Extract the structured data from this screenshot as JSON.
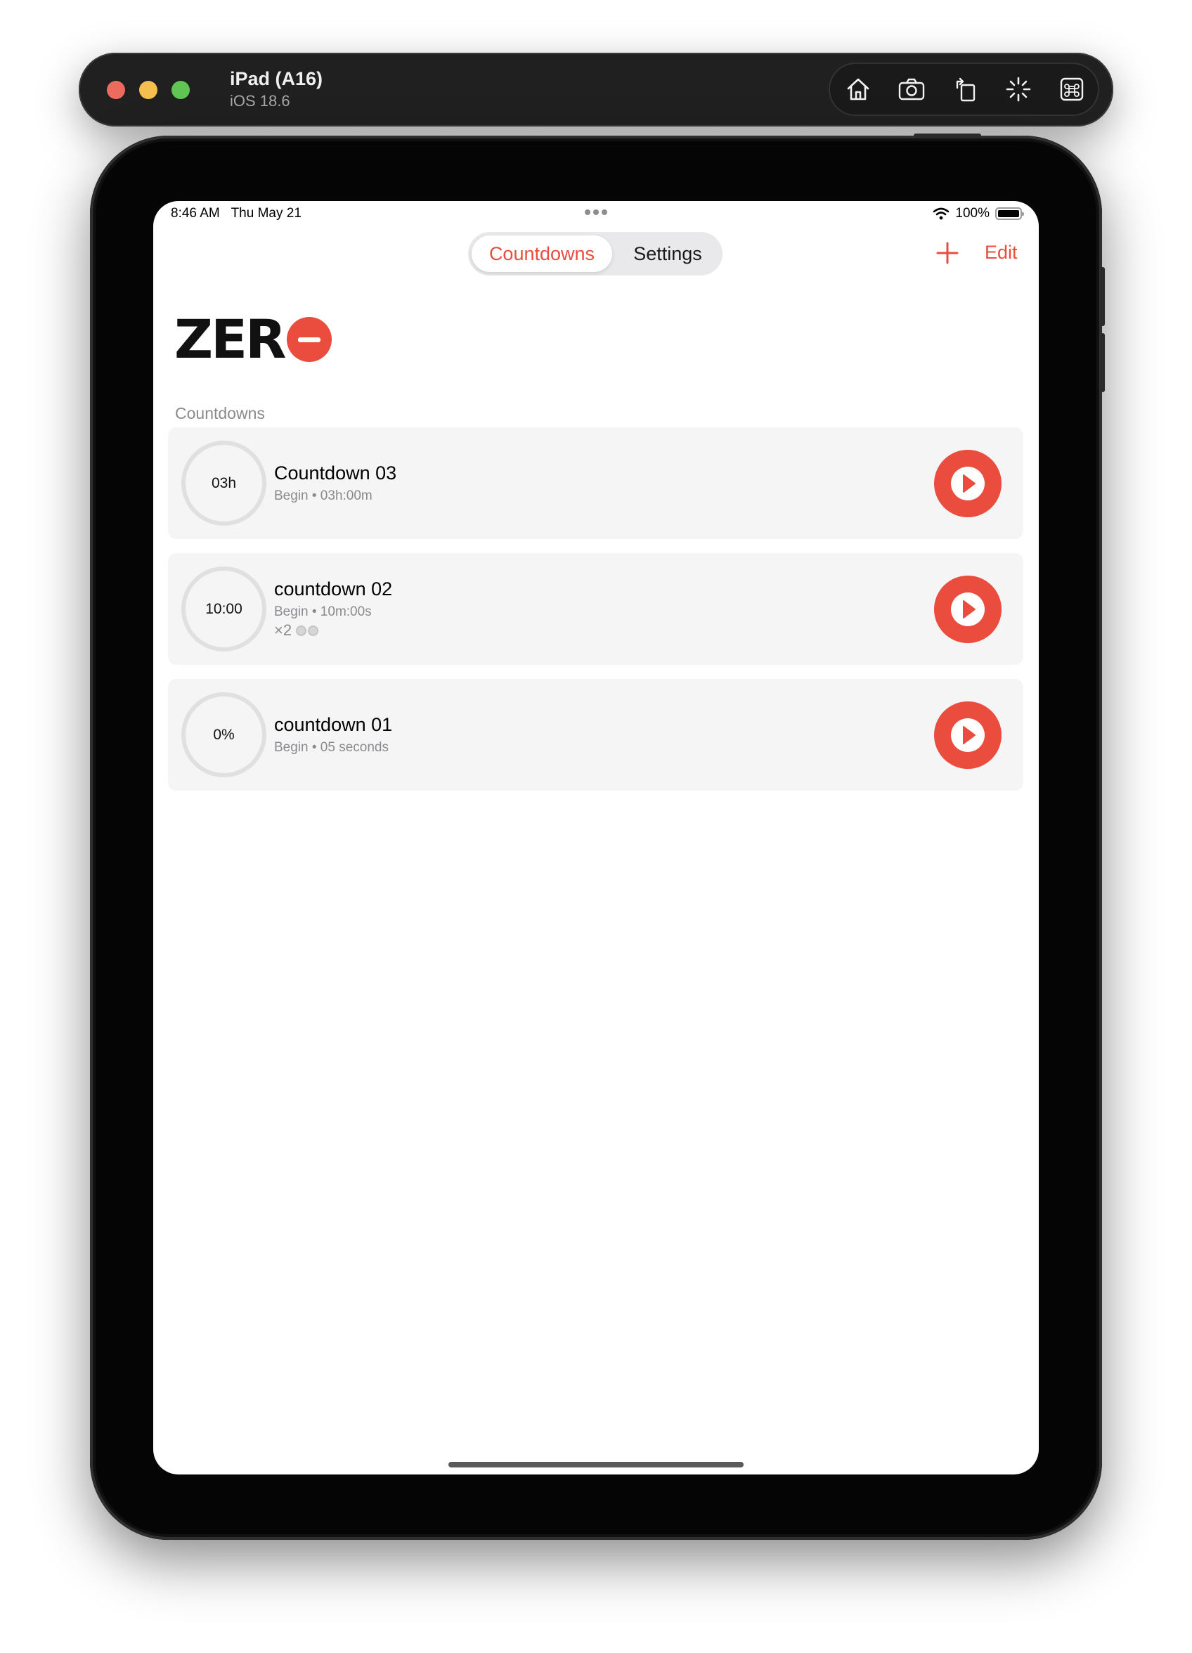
{
  "simulator": {
    "device_name": "iPad (A16)",
    "os_version": "iOS 18.6",
    "toolbar_icons": [
      "home-icon",
      "screenshot-icon",
      "rotate-icon",
      "brightness-icon",
      "command-icon"
    ]
  },
  "status_bar": {
    "time": "8:46 AM",
    "date": "Thu May 21",
    "battery": "100%"
  },
  "nav": {
    "tabs": [
      {
        "label": "Countdowns",
        "selected": true
      },
      {
        "label": "Settings",
        "selected": false
      }
    ],
    "edit_label": "Edit",
    "add_icon": "plus-icon"
  },
  "app": {
    "logo_text": "ZER",
    "accent_color": "#ea4c3d"
  },
  "section": {
    "header": "Countdowns"
  },
  "countdowns": [
    {
      "ring_label": "03h",
      "title": "Countdown 03",
      "subtitle": "Begin • 03h:00m",
      "repeat": ""
    },
    {
      "ring_label": "10:00",
      "title": "countdown 02",
      "subtitle": "Begin • 10m:00s",
      "repeat": "×2"
    },
    {
      "ring_label": "0%",
      "title": "countdown 01",
      "subtitle": "Begin • 05 seconds",
      "repeat": ""
    }
  ]
}
